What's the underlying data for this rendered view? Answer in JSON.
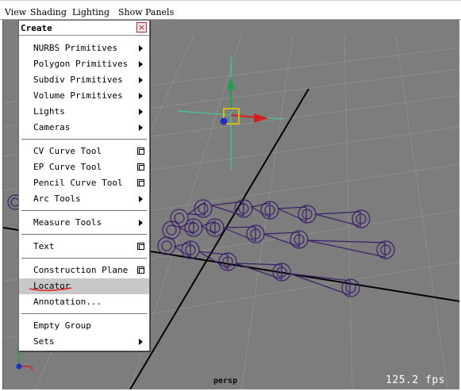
{
  "menubar": {
    "items": [
      "View",
      "Shading",
      "Lighting",
      "Show",
      "Panels"
    ]
  },
  "create_menu": {
    "title": "Create",
    "close_glyph": "×",
    "items": [
      {
        "label": "NURBS Primitives",
        "kind": "submenu"
      },
      {
        "label": "Polygon Primitives",
        "kind": "submenu"
      },
      {
        "label": "Subdiv Primitives",
        "kind": "submenu"
      },
      {
        "label": "Volume Primitives",
        "kind": "submenu"
      },
      {
        "label": "Lights",
        "kind": "submenu"
      },
      {
        "label": "Cameras",
        "kind": "submenu"
      },
      {
        "kind": "separator"
      },
      {
        "label": "CV Curve Tool",
        "kind": "option"
      },
      {
        "label": "EP Curve Tool",
        "kind": "option"
      },
      {
        "label": "Pencil Curve Tool",
        "kind": "option"
      },
      {
        "label": "Arc Tools",
        "kind": "submenu"
      },
      {
        "kind": "separator"
      },
      {
        "label": "Measure Tools",
        "kind": "submenu"
      },
      {
        "kind": "separator"
      },
      {
        "label": "Text",
        "kind": "option"
      },
      {
        "kind": "separator"
      },
      {
        "label": "Construction Plane",
        "kind": "option"
      },
      {
        "label": "Locator",
        "kind": "plain",
        "highlighted": true
      },
      {
        "label": "Annotation...",
        "kind": "plain"
      },
      {
        "kind": "separator"
      },
      {
        "label": "Empty Group",
        "kind": "plain"
      },
      {
        "label": "Sets",
        "kind": "submenu"
      }
    ]
  },
  "viewport": {
    "camera_label": "persp",
    "fps_text": "125.2 fps",
    "background": "#7d7d7d",
    "skeleton_color": "#3c1f6a",
    "axis_x_color": "#d02020",
    "axis_y_color": "#20a050"
  },
  "axes_gizmo": {
    "x_label": "x",
    "y_label": "y"
  },
  "icons": {
    "submenu": "triangle-right-icon",
    "option": "option-box-icon",
    "close": "close-icon"
  }
}
